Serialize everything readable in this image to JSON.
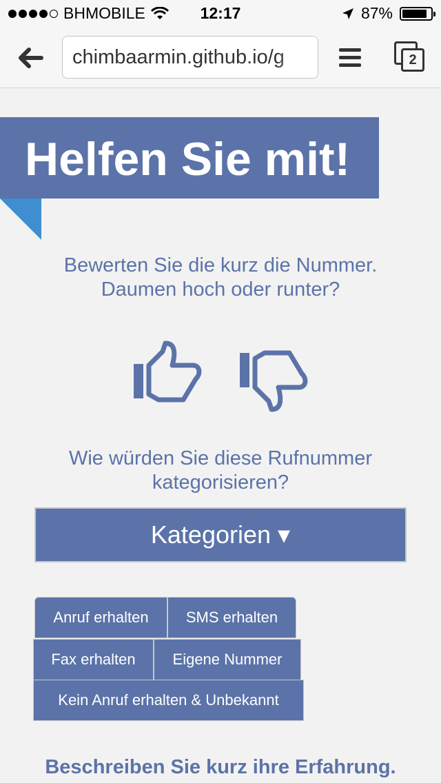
{
  "status_bar": {
    "carrier": "BHMOBILE",
    "time": "12:17",
    "battery": "87%",
    "battery_level": 0.87
  },
  "browser": {
    "url": "chimbaarmin.github.io/g",
    "tab_count": "2"
  },
  "banner": {
    "title": "Helfen Sie mit!"
  },
  "rating": {
    "question_line1": "Bewerten Sie die kurz die Nummer.",
    "question_line2": "Daumen hoch oder runter?"
  },
  "category": {
    "question_line1": "Wie würden Sie diese Rufnummer",
    "question_line2": "kategorisieren?",
    "dropdown_label": "Kategorien ▾"
  },
  "options": [
    "Anruf erhalten",
    "SMS erhalten",
    "Fax erhalten",
    "Eigene Nummer",
    "Kein Anruf erhalten & Unbekannt"
  ],
  "experience": {
    "prompt": "Beschreiben Sie kurz ihre Erfahrung."
  },
  "colors": {
    "accent": "#5b73a8",
    "fold": "#3f8fd0",
    "background": "#f2f2f2"
  }
}
